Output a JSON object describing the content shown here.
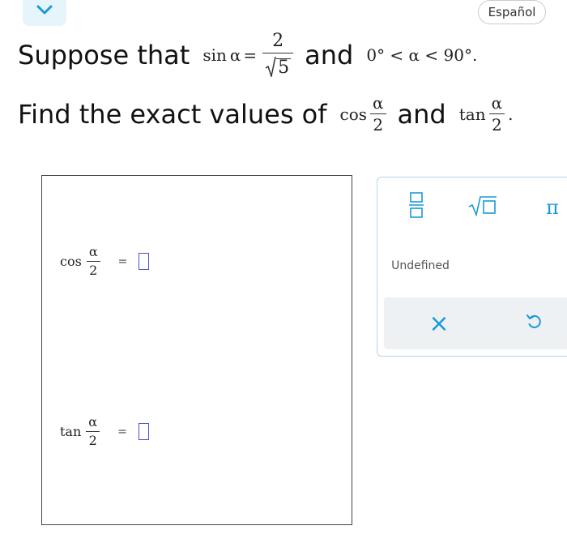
{
  "header": {
    "language_button": "Español",
    "collapse_icon": "chevron-down-icon",
    "accent_color": "#1a9ad6"
  },
  "question": {
    "line1_text_a": "Suppose that",
    "line1_text_b": "and",
    "sin_func": "sin",
    "alpha": "α",
    "equals": "=",
    "numerator": "2",
    "radicand": "5",
    "range_text": "0° < α < 90°.",
    "line2_text_a": "Find the exact values of",
    "line2_text_b": "and",
    "cos_func": "cos",
    "tan_func": "tan",
    "half_denominator": "2",
    "period": "."
  },
  "answers": {
    "cos_label": "cos",
    "tan_label": "tan",
    "alpha": "α",
    "denominator": "2",
    "equals": "="
  },
  "palette": {
    "fraction_icon": "fraction-icon",
    "sqrt_icon": "square-root-icon",
    "pi_symbol": "π",
    "undefined_label": "Undefined",
    "clear_symbol": "×",
    "undo_icon": "undo-icon"
  }
}
